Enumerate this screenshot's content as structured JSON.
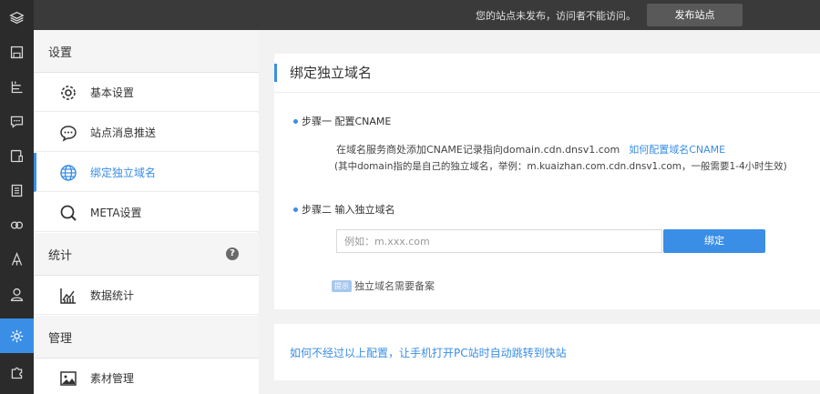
{
  "topbar": {
    "message": "您的站点未发布，访问者不能访问。",
    "publish_label": "发布站点"
  },
  "rail": {
    "items": [
      {
        "icon": "layers-icon"
      },
      {
        "icon": "save-icon"
      },
      {
        "icon": "structure-icon"
      },
      {
        "icon": "comment-icon"
      },
      {
        "icon": "device-icon"
      },
      {
        "icon": "document-icon"
      },
      {
        "icon": "plugin-icon"
      },
      {
        "icon": "rocket-icon"
      },
      {
        "icon": "user-icon"
      },
      {
        "icon": "settings-icon",
        "active": true
      },
      {
        "icon": "puzzle-icon"
      }
    ],
    "accent": "#3a8ee6"
  },
  "menu": {
    "sections": [
      {
        "title": "设置"
      },
      {
        "title": "统计",
        "help": "?"
      },
      {
        "title": "管理"
      }
    ],
    "items": [
      {
        "label": "基本设置",
        "icon": "gear-icon"
      },
      {
        "label": "站点消息推送",
        "icon": "chat-icon"
      },
      {
        "label": "绑定独立域名",
        "icon": "globe-icon",
        "selected": true
      },
      {
        "label": "META设置",
        "icon": "search-icon"
      },
      {
        "label": "数据统计",
        "icon": "chart-icon"
      },
      {
        "label": "素材管理",
        "icon": "image-icon"
      }
    ]
  },
  "main": {
    "title": "绑定独立域名",
    "step1": {
      "label": "步骤一  配置CNAME",
      "line1": "在域名服务商处添加CNAME记录指向domain.cdn.dnsv1.com",
      "link": "如何配置域名CNAME",
      "line2": "(其中domain指的是自己的独立域名，举例：m.kuaizhan.com.cdn.dnsv1.com，一般需要1-4小时生效)"
    },
    "step2": {
      "label": "步骤二  输入独立域名",
      "input_placeholder": "例如：m.xxx.com",
      "input_value": "",
      "bind_label": "绑定",
      "badge": "提示",
      "note": "独立域名需要备案"
    },
    "footer_link": "如何不经过以上配置，让手机打开PC站时自动跳转到快站"
  }
}
